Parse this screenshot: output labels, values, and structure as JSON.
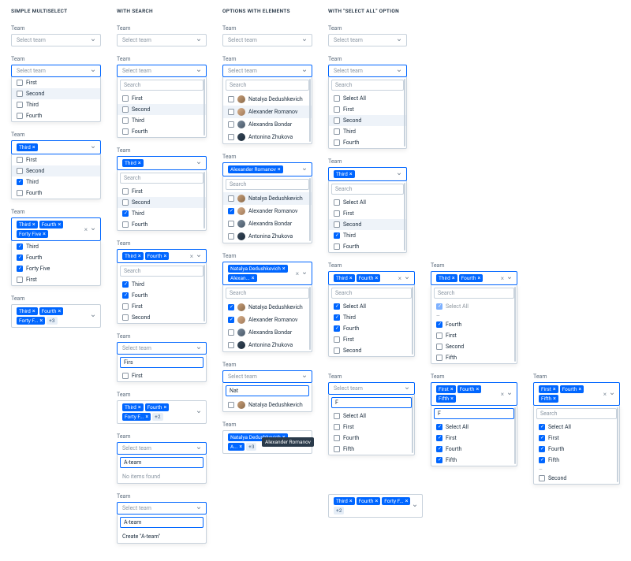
{
  "sections": {
    "simple": "SIMPLE MULTISELECT",
    "search": "WITH SEARCH",
    "elements": "OPTIONS WITH ELEMENTS",
    "selectall": "WITH \"SELECT ALL\" OPTION"
  },
  "label": "Team",
  "placeholder": "Select team",
  "searchPlaceholder": "Search",
  "options": {
    "first": "First",
    "second": "Second",
    "third": "Third",
    "fourth": "Fourth",
    "fifth": "Fifth",
    "fortyFive": "Forty Five",
    "fortyF": "Forty F...",
    "selectAll": "Select All"
  },
  "users": {
    "natalya": "Natalya Dedushkevich",
    "alexander": "Alexander Romanov",
    "alexandra": "Alexandra Bondar",
    "antonina": "Antonina Zhukova",
    "alexShort": "Alexan..."
  },
  "searchValues": {
    "firs": "Firs",
    "nat": "Nat",
    "ateam": "A-team",
    "f": "F"
  },
  "empty": "No items found",
  "create": "Create \"A-team\"",
  "tooltip": "Alexander Romanov",
  "moreChip": "+3",
  "moreChip2": "+2",
  "divider": "—"
}
